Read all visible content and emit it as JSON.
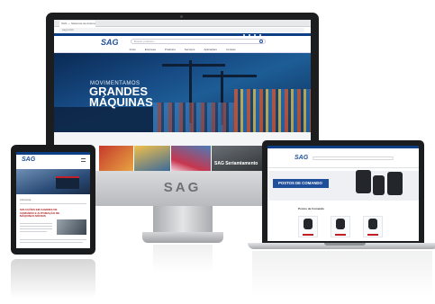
{
  "brand": {
    "name": "SAG",
    "accent": "#1f4f9b",
    "red": "#c21f29"
  },
  "desktop": {
    "tab_title": "SAG — Sistemas de Automação",
    "address": "sag.ind.br",
    "search_placeholder": "Buscar produtos...",
    "nav_items": [
      "Início",
      "Empresa",
      "Produtos",
      "Serviços",
      "Aplicações",
      "Contato"
    ],
    "hero_line1": "MOVIMENTAMOS",
    "hero_line2": "GRANDES",
    "hero_line3": "MÁQUINAS",
    "tile_label": "SAG Seriamtamento",
    "chin_brand": "SAG"
  },
  "tablet": {
    "logo": "SAG",
    "small_heading": "A Empresa",
    "article_title": "SOLUÇÕES EM CABINES DE COMANDO E AUTOMAÇÃO DE MÁQUINAS MÓVEIS"
  },
  "laptop": {
    "logo": "SAG",
    "banner": "POSTOS DE COMANDO",
    "section_title": "Postos de Comando",
    "product_count": 3
  },
  "icons": [
    "monitor-camera-icon",
    "search-icon",
    "social-icons"
  ]
}
